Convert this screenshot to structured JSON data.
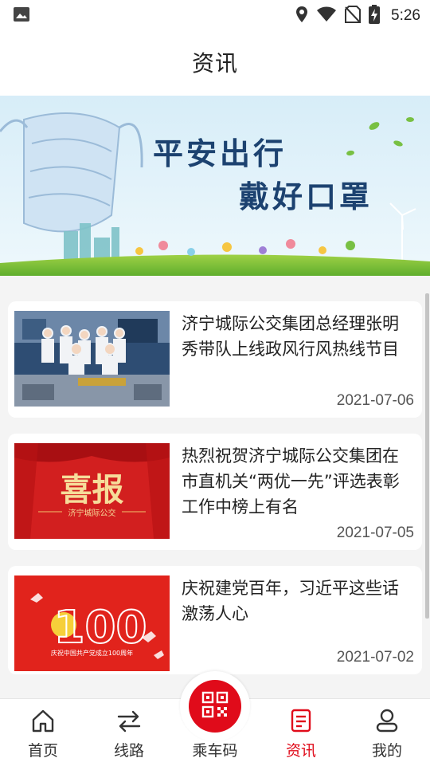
{
  "status_bar": {
    "time": "5:26",
    "icons": [
      "image-icon",
      "location-icon",
      "wifi-icon",
      "no-sim-icon",
      "battery-charging-icon"
    ]
  },
  "header": {
    "title": "资讯"
  },
  "banner": {
    "line1": "平安出行",
    "line2": "戴好口罩"
  },
  "news": [
    {
      "title": "济宁城际公交集团总经理张明秀带队上线政风行风热线节目",
      "date": "2021-07-06"
    },
    {
      "title": "热烈祝贺济宁城际公交集团在市直机关“两优一先”评选表彰工作中榜上有名",
      "date": "2021-07-05",
      "thumb_text": "喜报",
      "thumb_subtext": "济宁城际公交"
    },
    {
      "title": "庆祝建党百年，习近平这些话激荡人心",
      "date": "2021-07-02",
      "thumb_number": "100",
      "thumb_caption": "庆祝中国共产党成立100周年"
    }
  ],
  "tabbar": {
    "items": [
      {
        "label": "首页",
        "icon": "home-icon",
        "active": false
      },
      {
        "label": "线路",
        "icon": "route-arrows-icon",
        "active": false
      },
      {
        "label": "乘车码",
        "icon": "qr-code-icon",
        "active": false
      },
      {
        "label": "资讯",
        "icon": "news-icon",
        "active": true
      },
      {
        "label": "我的",
        "icon": "user-icon",
        "active": false
      }
    ]
  },
  "colors": {
    "accent": "#e00b1a",
    "banner_text": "#1c4270"
  }
}
